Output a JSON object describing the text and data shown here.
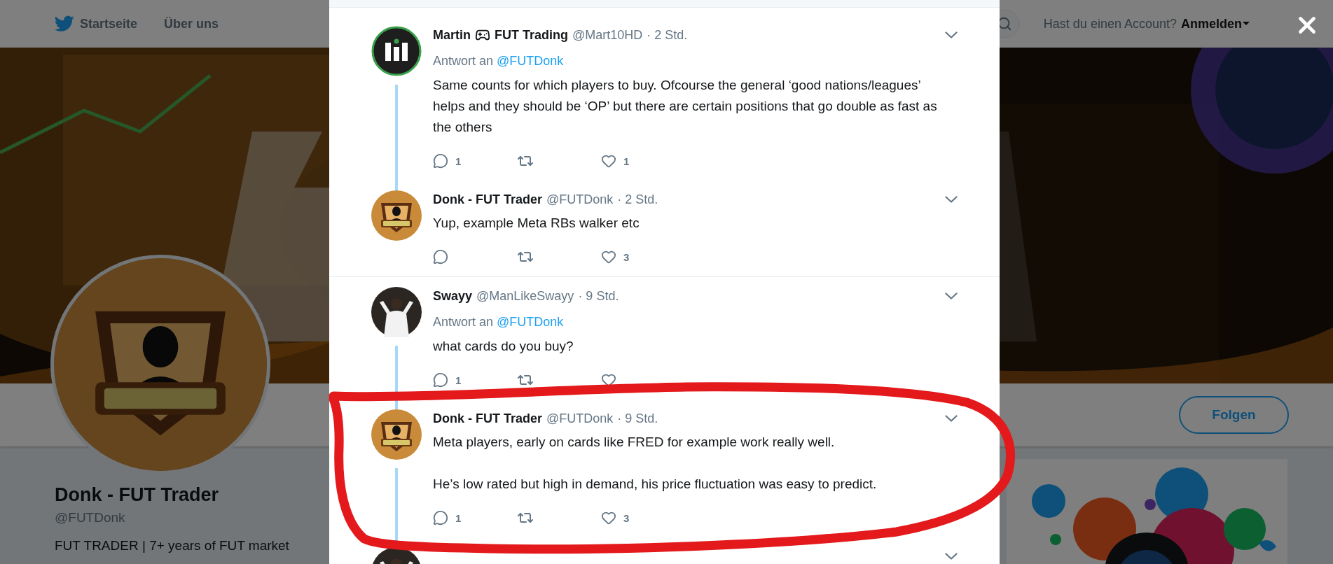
{
  "nav": {
    "items": [
      {
        "label": "Startseite"
      },
      {
        "label": "Über uns"
      }
    ],
    "account_prompt": "Hast du einen Account?",
    "login": "Anmelden"
  },
  "profile": {
    "name": "Donk - FUT Trader",
    "handle": "@FUTDonk",
    "bio": "FUT TRADER | 7+ years of FUT market",
    "follow_button": "Folgen"
  },
  "tweets": [
    {
      "name": "Martin",
      "name_suffix": "FUT Trading",
      "handle": "@Mart10HD",
      "time": "· 2 Std.",
      "reply_to_label": "Antwort an",
      "reply_to": "@FUTDonk",
      "paragraphs": [
        "Same counts for which players to buy. Ofcourse the general ‘good nations/leagues’ helps and they should be ‘OP’ but there are certain positions that go double as fast as the others"
      ],
      "reply_count": "1",
      "like_count": "1",
      "thread_line": true
    },
    {
      "name": "Donk - FUT Trader",
      "handle": "@FUTDonk",
      "time": "· 2 Std.",
      "paragraphs": [
        "Yup, example Meta RBs walker etc"
      ],
      "like_count": "3",
      "thread_line": false
    },
    {
      "name": "Swayy",
      "handle": "@ManLikeSwayy",
      "time": "· 9 Std.",
      "reply_to_label": "Antwort an",
      "reply_to": "@FUTDonk",
      "paragraphs": [
        "what cards do you buy?"
      ],
      "reply_count": "1",
      "thread_line": true
    },
    {
      "name": "Donk - FUT Trader",
      "handle": "@FUTDonk",
      "time": "· 9 Std.",
      "paragraphs": [
        "Meta players, early on cards like FRED for example work really well.",
        "He’s low rated but high in demand, his price fluctuation was easy to predict."
      ],
      "reply_count": "1",
      "like_count": "3",
      "thread_line": true
    },
    {
      "thread_line": false
    }
  ]
}
